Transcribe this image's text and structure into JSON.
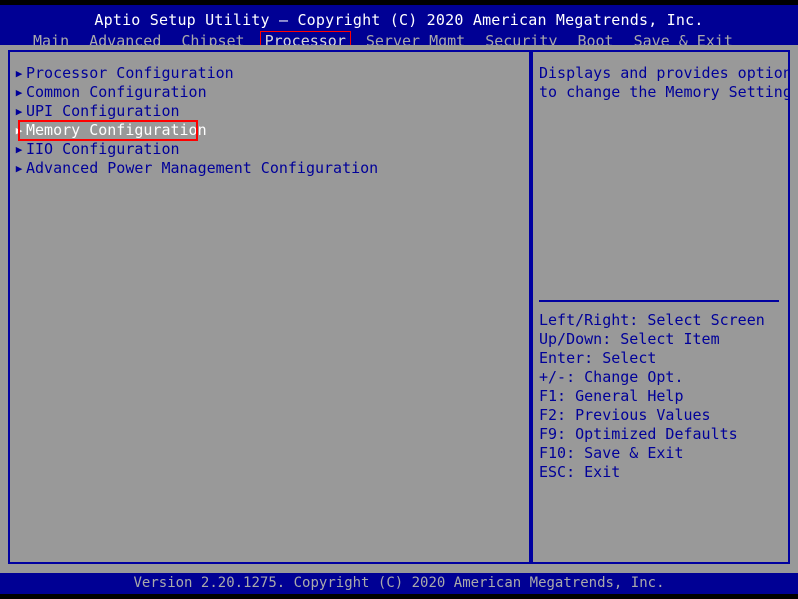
{
  "window": {
    "title": "Aptio Setup Utility – Copyright (C) 2020 American Megatrends, Inc."
  },
  "colors": {
    "header_blue": "#000094",
    "panel_gray": "#999999",
    "text_blue": "#000099",
    "border_blue": "#0000a0",
    "selection_red": "#ff0000",
    "selected_text": "#ffffff",
    "tab_text": "#aaaaaa",
    "black": "#000000"
  },
  "menubar": {
    "tabs": [
      {
        "label": "Main",
        "active": false
      },
      {
        "label": "Advanced",
        "active": false
      },
      {
        "label": "Chipset",
        "active": false
      },
      {
        "label": "Processor",
        "active": true
      },
      {
        "label": "Server Mgmt",
        "active": false
      },
      {
        "label": "Security",
        "active": false
      },
      {
        "label": "Boot",
        "active": false
      },
      {
        "label": "Save & Exit",
        "active": false
      }
    ],
    "active_tab": "Processor"
  },
  "main_panel": {
    "items": [
      {
        "label": "Processor Configuration",
        "arrow": "submenu-arrow-icon",
        "selected": false
      },
      {
        "label": "Common Configuration",
        "arrow": "submenu-arrow-icon",
        "selected": false
      },
      {
        "label": "UPI Configuration",
        "arrow": "submenu-arrow-icon",
        "selected": false
      },
      {
        "label": "Memory Configuration",
        "arrow": "submenu-arrow-icon",
        "selected": true
      },
      {
        "label": "IIO Configuration",
        "arrow": "submenu-arrow-icon",
        "selected": false
      },
      {
        "label": "Advanced Power Management Configuration",
        "arrow": "submenu-arrow-icon",
        "selected": false
      }
    ],
    "arrow_glyph": "▶"
  },
  "help_panel": {
    "description_lines": [
      "Displays and provides option",
      "to change the Memory Settings"
    ],
    "key_legend": [
      "Left/Right: Select Screen",
      "Up/Down: Select Item",
      "Enter: Select",
      "+/-: Change Opt.",
      "F1: General Help",
      "F2: Previous Values",
      "F9: Optimized Defaults",
      "F10: Save & Exit",
      "ESC: Exit"
    ]
  },
  "footer": {
    "version_text": "Version 2.20.1275. Copyright (C) 2020 American Megatrends, Inc."
  }
}
